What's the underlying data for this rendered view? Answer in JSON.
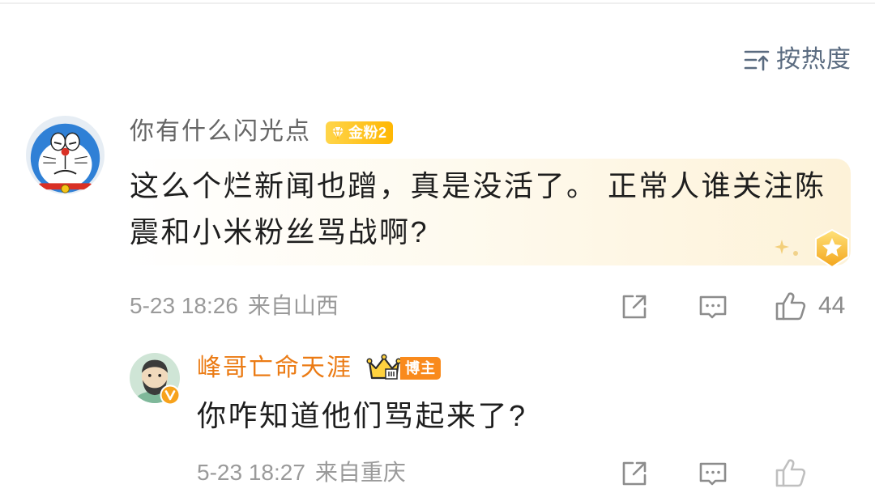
{
  "sort": {
    "label": "按热度",
    "icon": "sort-by-hot-icon"
  },
  "comment": {
    "avatar_icon": "doraemon-avatar",
    "username": "你有什么闪光点",
    "fan_badge": "金粉2",
    "text": "这么个烂新闻也蹭，真是没活了。 正常人谁关注陈震和小米粉丝骂战啊?",
    "time": "5-23 18:26",
    "location": "来自山西",
    "likes": "44",
    "actions": [
      "share-icon",
      "comment-icon",
      "like-icon"
    ]
  },
  "reply": {
    "avatar_icon": "bearded-man-avatar",
    "verified_icon": "verified-v-icon",
    "username": "峰哥亡命天涯",
    "role_badge": "博主",
    "text": "你咋知道他们骂起来了?",
    "time": "5-23 18:27",
    "location": "来自重庆",
    "actions": [
      "share-icon",
      "comment-icon",
      "like-icon"
    ]
  },
  "colors": {
    "background": "#ffffff",
    "username_gray": "#666666",
    "username_orange": "#eb7b14",
    "body_text": "#1e1e1e",
    "meta_gray": "#9a9a9a",
    "sort_text": "#5a6b80",
    "fan_badge": "#ffc125",
    "role_badge": "#f98a1c"
  }
}
